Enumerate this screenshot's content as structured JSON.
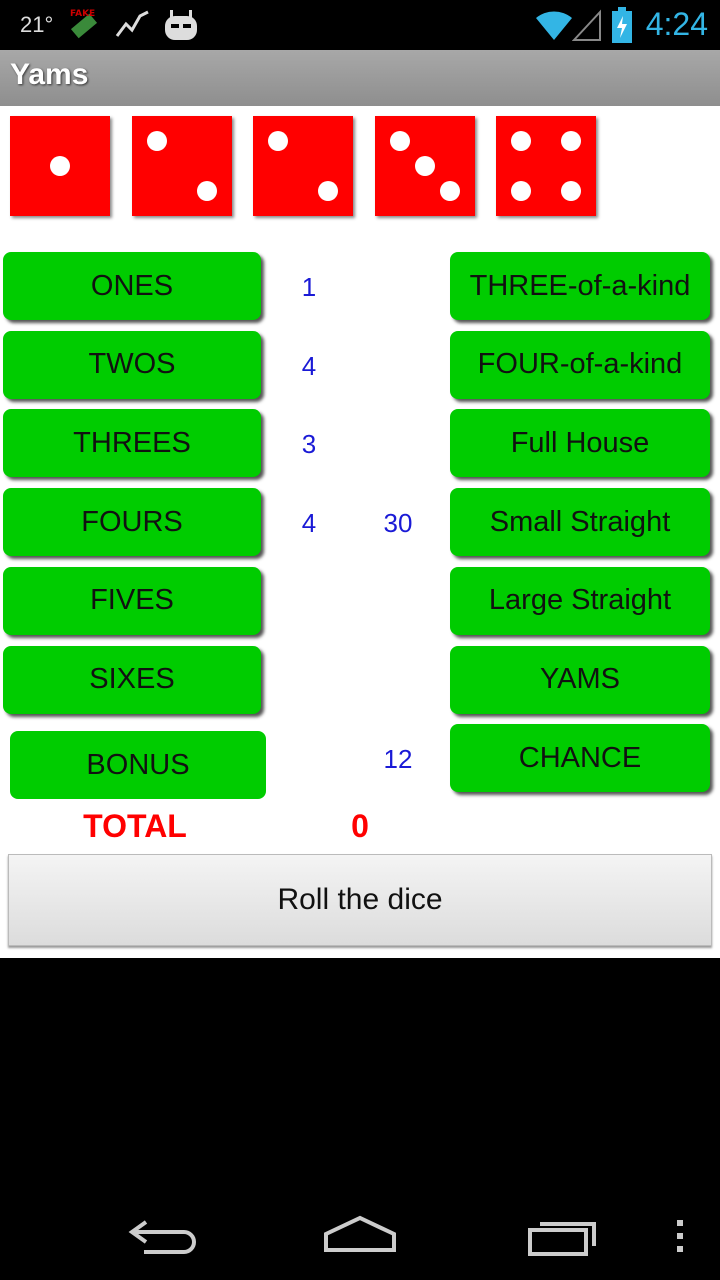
{
  "status_bar": {
    "temperature": "21°",
    "time": "4:24"
  },
  "app": {
    "title": "Yams"
  },
  "dice": [
    {
      "value": 1
    },
    {
      "value": 2
    },
    {
      "value": 2
    },
    {
      "value": 3
    },
    {
      "value": 4
    }
  ],
  "upper_section": [
    {
      "label": "ONES",
      "score": "1"
    },
    {
      "label": "TWOS",
      "score": "4"
    },
    {
      "label": "THREES",
      "score": "3"
    },
    {
      "label": "FOURS",
      "score": "4"
    },
    {
      "label": "FIVES",
      "score": ""
    },
    {
      "label": "SIXES",
      "score": ""
    }
  ],
  "bonus": {
    "label": "BONUS"
  },
  "lower_section": [
    {
      "label": "THREE-of-a-kind",
      "score": ""
    },
    {
      "label": "FOUR-of-a-kind",
      "score": ""
    },
    {
      "label": "Full House",
      "score": ""
    },
    {
      "label": "Small Straight",
      "score": "30"
    },
    {
      "label": "Large Straight",
      "score": ""
    },
    {
      "label": "YAMS",
      "score": ""
    },
    {
      "label": "CHANCE",
      "score": "12"
    }
  ],
  "total": {
    "label": "TOTAL",
    "value": "0"
  },
  "roll_button": {
    "label": "Roll the dice"
  },
  "colors": {
    "die": "#ff0000",
    "category_button": "#00cc00",
    "score_text": "#1a1ad6",
    "total_text": "#ff0000",
    "time_text": "#33b5e5"
  },
  "icons": {
    "status": [
      "fake-gps-icon",
      "activity-graph-icon",
      "cyanogenmod-icon",
      "wifi-icon",
      "signal-icon",
      "battery-charging-icon"
    ],
    "nav": [
      "back-icon",
      "home-icon",
      "recent-apps-icon",
      "menu-icon"
    ]
  }
}
